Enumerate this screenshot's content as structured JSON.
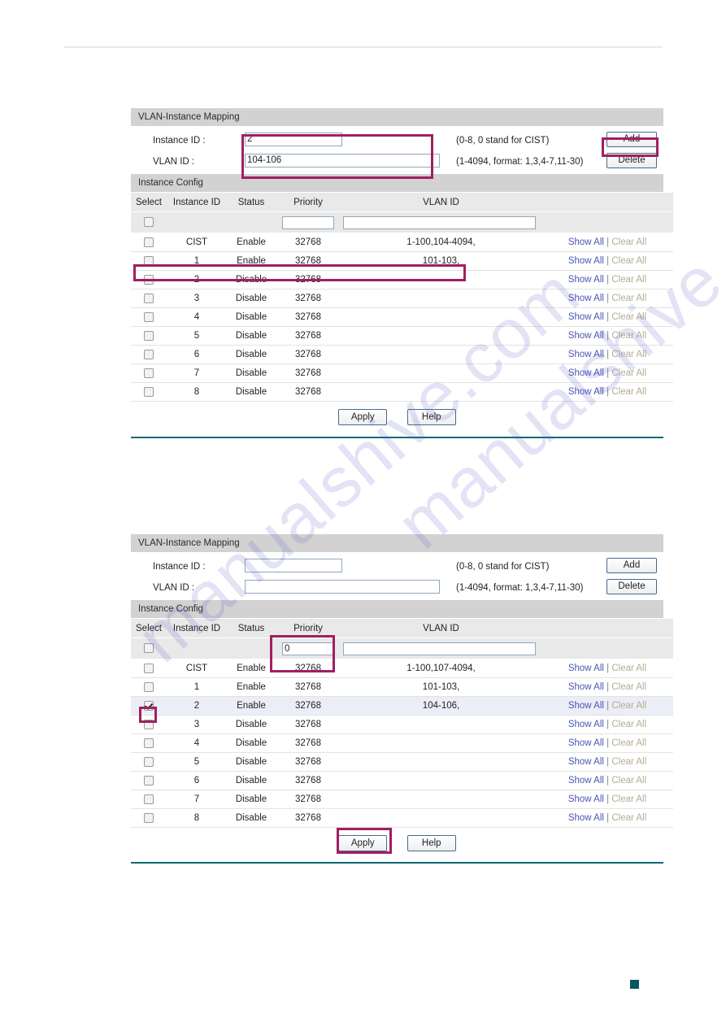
{
  "page": {
    "watermark": "manualshive.com"
  },
  "panels": [
    {
      "mapping": {
        "title": "VLAN-Instance Mapping",
        "instance_label": "Instance ID :",
        "instance_value": "2",
        "instance_hint": "(0-8, 0 stand for CIST)",
        "vlan_label": "VLAN ID :",
        "vlan_value": "104-106",
        "vlan_hint": "(1-4094, format: 1,3,4-7,11-30)",
        "add_label": "Add",
        "delete_label": "Delete"
      },
      "config": {
        "title": "Instance Config",
        "columns": {
          "select": "Select",
          "instance_id": "Instance ID",
          "status": "Status",
          "priority": "Priority",
          "vlan_id": "VLAN ID"
        },
        "filter": {
          "priority_value": "",
          "vlan_value": ""
        },
        "actions": {
          "show_all": "Show All",
          "separator": "|",
          "clear_all": "Clear All"
        },
        "rows": [
          {
            "instance_id": "CIST",
            "status": "Enable",
            "priority": "32768",
            "vlan_id": "1-100,104-4094,"
          },
          {
            "instance_id": "1",
            "status": "Enable",
            "priority": "32768",
            "vlan_id": "101-103,"
          },
          {
            "instance_id": "2",
            "status": "Disable",
            "priority": "32768",
            "vlan_id": ""
          },
          {
            "instance_id": "3",
            "status": "Disable",
            "priority": "32768",
            "vlan_id": ""
          },
          {
            "instance_id": "4",
            "status": "Disable",
            "priority": "32768",
            "vlan_id": ""
          },
          {
            "instance_id": "5",
            "status": "Disable",
            "priority": "32768",
            "vlan_id": ""
          },
          {
            "instance_id": "6",
            "status": "Disable",
            "priority": "32768",
            "vlan_id": ""
          },
          {
            "instance_id": "7",
            "status": "Disable",
            "priority": "32768",
            "vlan_id": ""
          },
          {
            "instance_id": "8",
            "status": "Disable",
            "priority": "32768",
            "vlan_id": ""
          }
        ],
        "apply_label": "Apply",
        "help_label": "Help"
      }
    },
    {
      "mapping": {
        "title": "VLAN-Instance Mapping",
        "instance_label": "Instance ID :",
        "instance_value": "",
        "instance_hint": "(0-8, 0 stand for CIST)",
        "vlan_label": "VLAN ID :",
        "vlan_value": "",
        "vlan_hint": "(1-4094, format: 1,3,4-7,11-30)",
        "add_label": "Add",
        "delete_label": "Delete"
      },
      "config": {
        "title": "Instance Config",
        "columns": {
          "select": "Select",
          "instance_id": "Instance ID",
          "status": "Status",
          "priority": "Priority",
          "vlan_id": "VLAN ID"
        },
        "filter": {
          "priority_value": "0",
          "vlan_value": ""
        },
        "actions": {
          "show_all": "Show All",
          "separator": "|",
          "clear_all": "Clear All"
        },
        "rows": [
          {
            "instance_id": "CIST",
            "status": "Enable",
            "priority": "32768",
            "vlan_id": "1-100,107-4094,"
          },
          {
            "instance_id": "1",
            "status": "Enable",
            "priority": "32768",
            "vlan_id": "101-103,"
          },
          {
            "instance_id": "2",
            "status": "Enable",
            "priority": "32768",
            "vlan_id": "104-106,"
          },
          {
            "instance_id": "3",
            "status": "Disable",
            "priority": "32768",
            "vlan_id": ""
          },
          {
            "instance_id": "4",
            "status": "Disable",
            "priority": "32768",
            "vlan_id": ""
          },
          {
            "instance_id": "5",
            "status": "Disable",
            "priority": "32768",
            "vlan_id": ""
          },
          {
            "instance_id": "6",
            "status": "Disable",
            "priority": "32768",
            "vlan_id": ""
          },
          {
            "instance_id": "7",
            "status": "Disable",
            "priority": "32768",
            "vlan_id": ""
          },
          {
            "instance_id": "8",
            "status": "Disable",
            "priority": "32768",
            "vlan_id": ""
          }
        ],
        "apply_label": "Apply",
        "help_label": "Help"
      }
    }
  ],
  "colors": {
    "highlight": "#a01f62",
    "rule": "#0e6b74",
    "link": "#4a55b4"
  }
}
